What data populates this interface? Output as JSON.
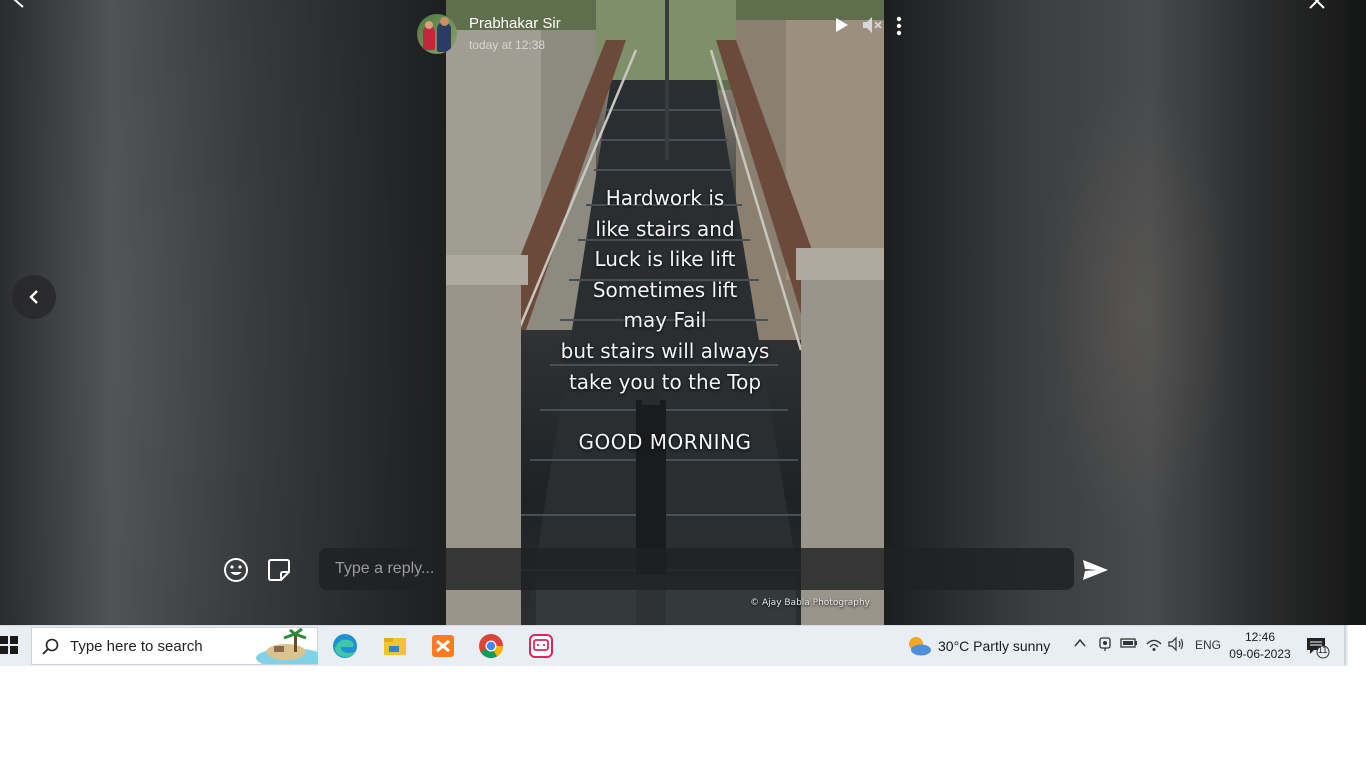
{
  "story": {
    "sender_name": "Prabhakar Sir",
    "timestamp": "today at 12:38",
    "quote_lines": [
      "Hardwork is",
      "like stairs and",
      "Luck is like lift",
      "Sometimes lift",
      "may Fail",
      "but stairs will always",
      "take you to the Top"
    ],
    "greeting": "GOOD MORNING",
    "credit": "© Ajay Babla Photography"
  },
  "reply": {
    "placeholder": "Type a reply..."
  },
  "icons": {
    "back": "chevron-left-icon",
    "close": "close-icon",
    "play": "play-icon",
    "mute": "mute-icon",
    "more": "more-vertical-icon",
    "emoji": "emoji-icon",
    "sticker": "sticker-icon",
    "send": "send-icon"
  },
  "taskbar": {
    "search_placeholder": "Type here to search",
    "weather_text": "30°C  Partly sunny",
    "language": "ENG",
    "clock_time": "12:46",
    "clock_date": "09-06-2023",
    "notification_count": "11"
  },
  "colors": {
    "accent": "#2a78d6",
    "taskbar": "#e9eef4"
  }
}
